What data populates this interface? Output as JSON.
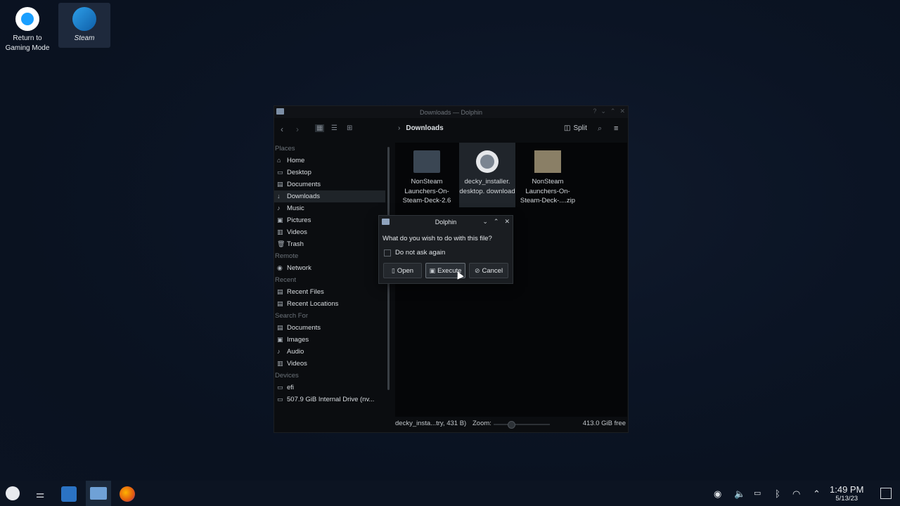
{
  "desktop": {
    "icons": [
      {
        "label": "Return to Gaming Mode"
      },
      {
        "label": "Steam"
      }
    ]
  },
  "window": {
    "title": "Downloads — Dolphin",
    "breadcrumb": "Downloads",
    "split_label": "Split",
    "places": {
      "sections": [
        {
          "title": "Places",
          "items": [
            "Home",
            "Desktop",
            "Documents",
            "Downloads",
            "Music",
            "Pictures",
            "Videos",
            "Trash"
          ]
        },
        {
          "title": "Remote",
          "items": [
            "Network"
          ]
        },
        {
          "title": "Recent",
          "items": [
            "Recent Files",
            "Recent Locations"
          ]
        },
        {
          "title": "Search For",
          "items": [
            "Documents",
            "Images",
            "Audio",
            "Videos"
          ]
        },
        {
          "title": "Devices",
          "items": [
            "efi",
            "507.9 GiB Internal Drive (nv..."
          ]
        }
      ]
    },
    "files": [
      {
        "name": "NonSteam Launchers-On- Steam-Deck-2.6",
        "icon": "folder-icon"
      },
      {
        "name": "decky_installer. desktop. download",
        "icon": "download-file-icon"
      },
      {
        "name": "NonSteam Launchers-On- Steam-Deck-....zip",
        "icon": "zip-icon"
      }
    ],
    "status": {
      "selection": "decky_insta...try, 431 B)",
      "zoom_label": "Zoom:",
      "free_space": "413.0 GiB free"
    }
  },
  "dialog": {
    "title": "Dolphin",
    "question": "What do you wish to do with this file?",
    "checkbox_label": "Do not ask again",
    "buttons": {
      "open": "Open",
      "execute": "Execute",
      "cancel": "Cancel"
    }
  },
  "taskbar": {
    "time": "1:49 PM",
    "date": "5/13/23"
  }
}
